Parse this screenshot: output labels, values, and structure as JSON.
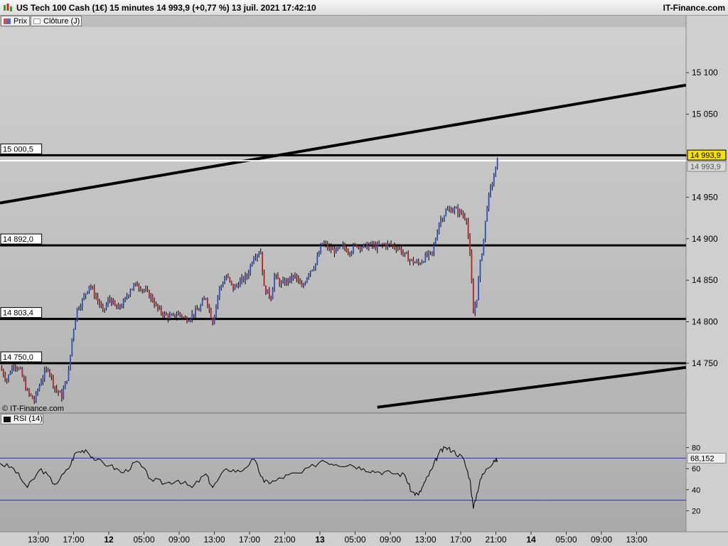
{
  "app": {
    "title": "US Tech 100 Cash (1€) 15 minutes 14 993,9 (+0,77 %) 13 juil. 2021 17:42:10",
    "brand": "IT-Finance.com",
    "copyright": "© IT-Finance.com"
  },
  "legend": {
    "price_label": "Prix",
    "close_label": "Clôture (J)",
    "rsi_label": "RSI (14)"
  },
  "colors": {
    "up": "#2c4fc4",
    "down": "#b8221d",
    "wick": "#000000",
    "rsi_band": "#2b2bd6",
    "current_price_box": "#f7e000"
  },
  "chart_data": {
    "type": "candlestick",
    "instrument": "US Tech 100 Cash (1€)",
    "interval": "15 minutes",
    "last_price": "14 993,9",
    "change": "+0,77 %",
    "ylim": [
      14690,
      15155
    ],
    "y_ticks": [
      "14 750",
      "14 800",
      "14 850",
      "14 900",
      "14 950",
      "15 000",
      "15 050",
      "15 100"
    ],
    "x_ticks": [
      "13:00",
      "17:00",
      "12",
      "05:00",
      "09:00",
      "13:00",
      "17:00",
      "21:00",
      "13",
      "05:00",
      "09:00",
      "13:00",
      "17:00",
      "21:00",
      "14",
      "05:00",
      "09:00",
      "13:00"
    ],
    "horizontal_levels": [
      {
        "label": "15 000,5",
        "value": 15000.5
      },
      {
        "label": "14 892,0",
        "value": 14892.0
      },
      {
        "label": "14 803,4",
        "value": 14803.4
      },
      {
        "label": "14 750,0",
        "value": 14750.0
      }
    ],
    "close_line": {
      "label": "14 993,9",
      "value": 14993.9
    },
    "current_price": {
      "label": "14 993,9",
      "value": 14993.9
    },
    "trendlines": [
      {
        "points": [
          [
            0,
            14943
          ],
          [
            1,
            15085
          ]
        ]
      },
      {
        "points": [
          [
            0.55,
            14697
          ],
          [
            1,
            14745
          ]
        ]
      }
    ],
    "price_path": [
      [
        0.0,
        14745
      ],
      [
        0.01,
        14730
      ],
      [
        0.02,
        14750
      ],
      [
        0.03,
        14740
      ],
      [
        0.04,
        14715
      ],
      [
        0.05,
        14705
      ],
      [
        0.06,
        14730
      ],
      [
        0.07,
        14745
      ],
      [
        0.08,
        14720
      ],
      [
        0.09,
        14710
      ],
      [
        0.1,
        14740
      ],
      [
        0.105,
        14780
      ],
      [
        0.112,
        14815
      ],
      [
        0.12,
        14825
      ],
      [
        0.13,
        14845
      ],
      [
        0.14,
        14830
      ],
      [
        0.15,
        14812
      ],
      [
        0.16,
        14828
      ],
      [
        0.17,
        14815
      ],
      [
        0.18,
        14822
      ],
      [
        0.19,
        14840
      ],
      [
        0.2,
        14845
      ],
      [
        0.21,
        14838
      ],
      [
        0.22,
        14830
      ],
      [
        0.23,
        14815
      ],
      [
        0.24,
        14808
      ],
      [
        0.25,
        14805
      ],
      [
        0.26,
        14810
      ],
      [
        0.27,
        14803
      ],
      [
        0.28,
        14808
      ],
      [
        0.29,
        14815
      ],
      [
        0.3,
        14830
      ],
      [
        0.31,
        14800
      ],
      [
        0.32,
        14840
      ],
      [
        0.33,
        14855
      ],
      [
        0.34,
        14840
      ],
      [
        0.35,
        14848
      ],
      [
        0.36,
        14855
      ],
      [
        0.37,
        14880
      ],
      [
        0.38,
        14885
      ],
      [
        0.385,
        14840
      ],
      [
        0.395,
        14830
      ],
      [
        0.4,
        14855
      ],
      [
        0.41,
        14845
      ],
      [
        0.42,
        14850
      ],
      [
        0.43,
        14855
      ],
      [
        0.44,
        14840
      ],
      [
        0.45,
        14860
      ],
      [
        0.46,
        14870
      ],
      [
        0.47,
        14895
      ],
      [
        0.48,
        14888
      ],
      [
        0.49,
        14885
      ],
      [
        0.5,
        14890
      ],
      [
        0.51,
        14885
      ],
      [
        0.52,
        14893
      ],
      [
        0.53,
        14890
      ],
      [
        0.54,
        14892
      ],
      [
        0.55,
        14890
      ],
      [
        0.56,
        14893
      ],
      [
        0.57,
        14892
      ],
      [
        0.58,
        14890
      ],
      [
        0.59,
        14880
      ],
      [
        0.6,
        14873
      ],
      [
        0.61,
        14870
      ],
      [
        0.62,
        14878
      ],
      [
        0.63,
        14882
      ],
      [
        0.635,
        14900
      ],
      [
        0.64,
        14920
      ],
      [
        0.65,
        14933
      ],
      [
        0.66,
        14936
      ],
      [
        0.67,
        14932
      ],
      [
        0.675,
        14928
      ],
      [
        0.68,
        14925
      ],
      [
        0.685,
        14880
      ],
      [
        0.69,
        14810
      ],
      [
        0.695,
        14830
      ],
      [
        0.7,
        14870
      ],
      [
        0.705,
        14900
      ],
      [
        0.71,
        14940
      ],
      [
        0.715,
        14960
      ],
      [
        0.72,
        14975
      ],
      [
        0.725,
        14993
      ]
    ]
  },
  "rsi": {
    "label": "RSI (14)",
    "value_label": "68,152",
    "ylim": [
      0,
      100
    ],
    "ticks": [
      "80",
      "60",
      "40",
      "20"
    ],
    "upper_band": 70,
    "lower_band": 30,
    "values": [
      [
        0.0,
        65
      ],
      [
        0.02,
        60
      ],
      [
        0.04,
        42
      ],
      [
        0.06,
        60
      ],
      [
        0.08,
        45
      ],
      [
        0.1,
        60
      ],
      [
        0.11,
        75
      ],
      [
        0.125,
        78
      ],
      [
        0.14,
        68
      ],
      [
        0.16,
        63
      ],
      [
        0.18,
        56
      ],
      [
        0.2,
        67
      ],
      [
        0.22,
        50
      ],
      [
        0.24,
        46
      ],
      [
        0.26,
        49
      ],
      [
        0.28,
        42
      ],
      [
        0.3,
        55
      ],
      [
        0.31,
        42
      ],
      [
        0.33,
        60
      ],
      [
        0.35,
        57
      ],
      [
        0.37,
        69
      ],
      [
        0.385,
        47
      ],
      [
        0.4,
        48
      ],
      [
        0.42,
        54
      ],
      [
        0.44,
        56
      ],
      [
        0.47,
        68
      ],
      [
        0.49,
        64
      ],
      [
        0.51,
        64
      ],
      [
        0.53,
        60
      ],
      [
        0.55,
        57
      ],
      [
        0.57,
        56
      ],
      [
        0.59,
        54
      ],
      [
        0.6,
        38
      ],
      [
        0.61,
        35
      ],
      [
        0.62,
        48
      ],
      [
        0.63,
        60
      ],
      [
        0.64,
        75
      ],
      [
        0.65,
        80
      ],
      [
        0.66,
        77
      ],
      [
        0.675,
        70
      ],
      [
        0.685,
        50
      ],
      [
        0.69,
        22
      ],
      [
        0.7,
        50
      ],
      [
        0.71,
        60
      ],
      [
        0.72,
        68
      ],
      [
        0.725,
        68
      ]
    ]
  }
}
